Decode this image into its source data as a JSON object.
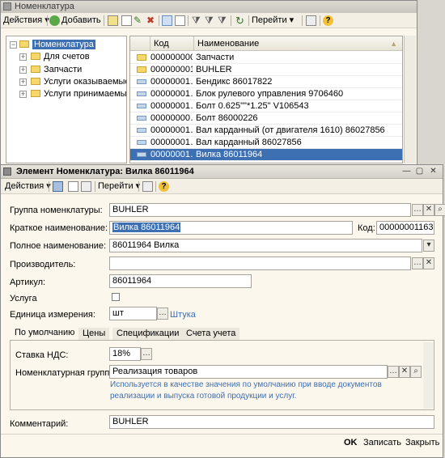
{
  "list_window": {
    "title": "Номенклатура",
    "toolbar": {
      "actions_label": "Действия",
      "add_label": "Добавить",
      "goto_label": "Перейти"
    },
    "tree": [
      {
        "label": "Номенклатура",
        "level": 0,
        "selected": true
      },
      {
        "label": "Для счетов",
        "level": 1
      },
      {
        "label": "Запчасти",
        "level": 1
      },
      {
        "label": "Услуги оказываемые",
        "level": 1
      },
      {
        "label": "Услуги принимаемые",
        "level": 1
      }
    ],
    "columns": {
      "code": "Код",
      "name": "Наименование"
    },
    "rows": [
      {
        "code": "000000000…",
        "name": "Запчасти",
        "folder": true
      },
      {
        "code": "000000001…",
        "name": "BUHLER",
        "folder": true
      },
      {
        "code": "00000001…",
        "name": "Бендикс 86017822"
      },
      {
        "code": "00000001…",
        "name": "Блок рулевого управления 9706460"
      },
      {
        "code": "00000001…",
        "name": "Болт 0.625\"\"*1.25\" V106543"
      },
      {
        "code": "00000000…",
        "name": "Болт 86000226"
      },
      {
        "code": "00000001…",
        "name": "Вал карданный (от двигателя 1610) 86027856"
      },
      {
        "code": "00000001…",
        "name": "Вал карданный 86027856"
      },
      {
        "code": "00000001…",
        "name": "Вилка 86011964",
        "selected": true
      }
    ]
  },
  "element_window": {
    "title": "Элемент Номенклатура: Вилка 86011964",
    "toolbar": {
      "actions_label": "Действия",
      "goto_label": "Перейти"
    },
    "fields": {
      "group_label": "Группа номенклатуры:",
      "group_value": "BUHLER",
      "short_name_label": "Краткое наименование:",
      "short_name_value": "Вилка 86011964",
      "code_label": "Код:",
      "code_value": "00000001163",
      "full_name_label": "Полное наименование:",
      "full_name_value": "86011964 Вилка",
      "manufacturer_label": "Производитель:",
      "manufacturer_value": "",
      "article_label": "Артикул:",
      "article_value": "86011964",
      "service_label": "Услуга",
      "unit_label": "Единица измерения:",
      "unit_value": "шт",
      "unit_link": "Штука"
    },
    "tabs": [
      "По умолчанию",
      "Цены",
      "Спецификации",
      "Счета учета"
    ],
    "tab_defaults": {
      "vat_label": "Ставка НДС:",
      "vat_value": "18%",
      "nom_group_label": "Номенклатурная группа:",
      "nom_group_value": "Реализация товаров",
      "hint_line1": "Используется в качестве значения по умолчанию при вводе документов",
      "hint_line2": "реализации и выпуска готовой продукции и услуг."
    },
    "comment_label": "Комментарий:",
    "comment_value": "BUHLER",
    "footer": {
      "ok": "OK",
      "save": "Записать",
      "close": "Закрыть"
    }
  },
  "colors": {
    "selection": "#3d6fb3",
    "window_bg": "#fbf7ec"
  }
}
